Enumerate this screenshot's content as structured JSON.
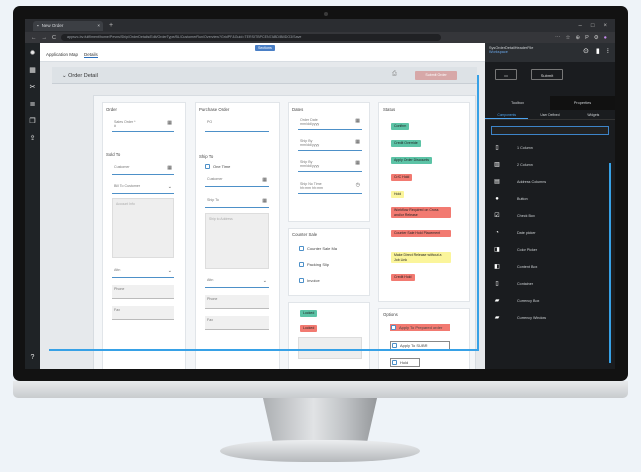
{
  "browser": {
    "tab_title": "New Order",
    "url": "appsvc-bv-fulfilment/home/Pevns/Ship/OrderDetails/Edit/OrderType/BL/CustomerRun/Overview?GridPF&Guid=TERSITBPCEN7ABD/BillDO3/Save",
    "new_tab": "+",
    "nav_back": "←",
    "nav_forward": "→",
    "nav_reload": "C",
    "ext_icons": [
      "⋯",
      "☆",
      "⊕",
      "P",
      "⚙",
      "●",
      "⋮"
    ]
  },
  "rail_icons": [
    "settings-icon",
    "grid-icon",
    "tools-icon",
    "list-icon",
    "copy-icon",
    "export-icon"
  ],
  "rail_glyphs": [
    "✹",
    "▦",
    "✂",
    "≣",
    "❐",
    "⇪"
  ],
  "rail_help": "?",
  "app": {
    "badge": "Sections",
    "tabs": [
      "Application Map",
      "Details"
    ]
  },
  "order_detail": {
    "title": "Order Detail",
    "print_icon": "⎙",
    "button": "Submit Order"
  },
  "order": {
    "title": "Order",
    "order_field": "Sales Order *",
    "order_value": "#"
  },
  "purchase_order": {
    "title": "Purchase Order",
    "po_field": "PO"
  },
  "sold_to": {
    "title": "Sold To",
    "customer": "Customer",
    "bill_to": "Bill To Customer",
    "address_box": "Account Info",
    "attn": "Attn",
    "phone": "Phone",
    "fax": "Fax"
  },
  "ship_to": {
    "title": "Ship To",
    "one_time": "One Time",
    "customer": "Customer",
    "ship_to": "Ship To",
    "address_box": "Ship to Address",
    "attn": "Attn",
    "phone": "Phone",
    "fax": "Fax"
  },
  "dates": {
    "title": "Dates",
    "fields": [
      {
        "label": "Order Date",
        "value": "mm/dd/yyyy"
      },
      {
        "label": "Ship By",
        "value": "mm/dd/yyyy"
      },
      {
        "label": "Ship By",
        "value": "mm/dd/yyyy"
      },
      {
        "label": "Ship No Time",
        "value": "hh:mm hh:mm"
      }
    ]
  },
  "counter_sale": {
    "title": "Counter Sale",
    "items": [
      "Counter Sale Ma",
      "Packing Slip",
      "Invoice"
    ]
  },
  "locked": {
    "pills": [
      {
        "label": "Locked",
        "color": "#5cc3a6"
      },
      {
        "label": "Locked",
        "color": "#f27a71"
      }
    ]
  },
  "status": {
    "title": "Status",
    "pills": [
      {
        "label": "Confirm",
        "color": "#5cc3a6"
      },
      {
        "label": "Credit Override",
        "color": "#5cc3a6"
      },
      {
        "label": "Apply Order Discounts",
        "color": "#5cc3a6"
      },
      {
        "label": "Cr/C Hold",
        "color": "#f27a71"
      },
      {
        "label": "Hold",
        "color": "#fbf59b"
      },
      {
        "label": "Workflow Required on Cross and/or Release",
        "color": "#f27a71"
      },
      {
        "label": "Counter Sale Hold Placement",
        "color": "#f27a71"
      },
      {
        "label": "Make Direct Release without a Job Link",
        "color": "#fbf59b"
      },
      {
        "label": "Credit Hold",
        "color": "#f27a71"
      }
    ]
  },
  "options": {
    "title": "Options",
    "items": [
      "Apply To Prepared order",
      "Apply To SUBR",
      "Hold"
    ]
  },
  "panel": {
    "title": "SysOrderDetailHeaderFile",
    "subtitle": "Workspace",
    "top_icons": [
      "⊙",
      "▮",
      "⁝"
    ],
    "preview_btn": "▭",
    "publish_btn": "Submit",
    "tabs": [
      "Toolbox",
      "Properties"
    ],
    "subtabs": [
      "Components",
      "User Defined",
      "Widgets"
    ],
    "components": [
      {
        "icon": "grid-icon",
        "glyph": "▯",
        "label": "1 Column"
      },
      {
        "icon": "columns-icon",
        "glyph": "▥",
        "label": "2 Column"
      },
      {
        "icon": "panel-icon",
        "glyph": "▤",
        "label": "Address Columns"
      },
      {
        "icon": "radio-icon",
        "glyph": "●",
        "label": "Button"
      },
      {
        "icon": "checkbox-icon",
        "glyph": "☑",
        "label": "Check Box"
      },
      {
        "icon": "clock-icon",
        "glyph": "◔",
        "label": "Date picker"
      },
      {
        "icon": "colorpicker-icon",
        "glyph": "◨",
        "label": "Color Picker"
      },
      {
        "icon": "container-icon",
        "glyph": "◧",
        "label": "Content Box"
      },
      {
        "icon": "container2-icon",
        "glyph": "▯",
        "label": "Container"
      },
      {
        "icon": "doc-icon",
        "glyph": "▰",
        "label": "Currency Box"
      },
      {
        "icon": "doc2-icon",
        "glyph": "▰",
        "label": "Currency Window"
      }
    ]
  }
}
